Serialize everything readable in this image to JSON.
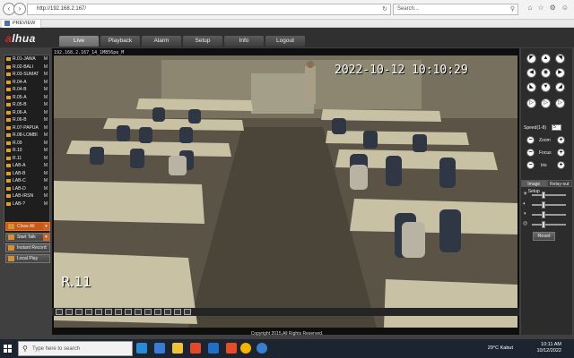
{
  "browser": {
    "url": "http://192.168.2.167/",
    "search_placeholder": "Search...",
    "tab": "PREVIEW"
  },
  "app": {
    "logo": "alhua",
    "menu": [
      "Live",
      "Playback",
      "Alarm",
      "Setup",
      "Info",
      "Logout"
    ],
    "active_menu": "Live"
  },
  "channels": [
    {
      "name": "R.01-JAWA",
      "m": "M"
    },
    {
      "name": "R.02-BALI",
      "m": "M"
    },
    {
      "name": "R.03-SUMAT",
      "m": "M"
    },
    {
      "name": "R.04-A",
      "m": "M"
    },
    {
      "name": "R.04-B",
      "m": "M"
    },
    {
      "name": "R.05-A",
      "m": "M"
    },
    {
      "name": "R.05-B",
      "m": "M"
    },
    {
      "name": "R.06-A",
      "m": "M"
    },
    {
      "name": "R.06-B",
      "m": "M"
    },
    {
      "name": "R.07-PAPUA",
      "m": "M"
    },
    {
      "name": "R.08-LOMBI",
      "m": "M"
    },
    {
      "name": "R.09",
      "m": "M"
    },
    {
      "name": "R.10",
      "m": "M"
    },
    {
      "name": "R.11",
      "m": "M"
    },
    {
      "name": "LAB-A",
      "m": "M"
    },
    {
      "name": "LAB-B",
      "m": "M"
    },
    {
      "name": "LAB-C",
      "m": "M"
    },
    {
      "name": "LAB-D",
      "m": "M"
    },
    {
      "name": "LAB-IRSN",
      "m": "M"
    },
    {
      "name": "LAB-?",
      "m": "M"
    }
  ],
  "side_buttons": {
    "close_all": "Close All",
    "start_talk": "Start Talk",
    "instant_record": "Instant Record",
    "local_play": "Local Play"
  },
  "video": {
    "info": "192.168.2.167_14_1MB56pe_M",
    "timestamp": "2022-10-12 10:10:29",
    "room_label": "R.11"
  },
  "ptz": {
    "speed_label": "Speed(1-8)",
    "speed_value": "5",
    "zoom": "Zoom",
    "focus": "Focus",
    "iris": "Iris"
  },
  "settings": {
    "tab_image": "Image Setup",
    "tab_relay": "Relay-out",
    "sliders": [
      0.35,
      0.35,
      0.35,
      0.35
    ],
    "reset": "Reset"
  },
  "footer": "Copyright 2015,All Rights Reserved.",
  "taskbar": {
    "search": "Type here to search",
    "weather": "29°C  Kabut",
    "time": "10:11 AM",
    "date": "10/12/2022"
  }
}
